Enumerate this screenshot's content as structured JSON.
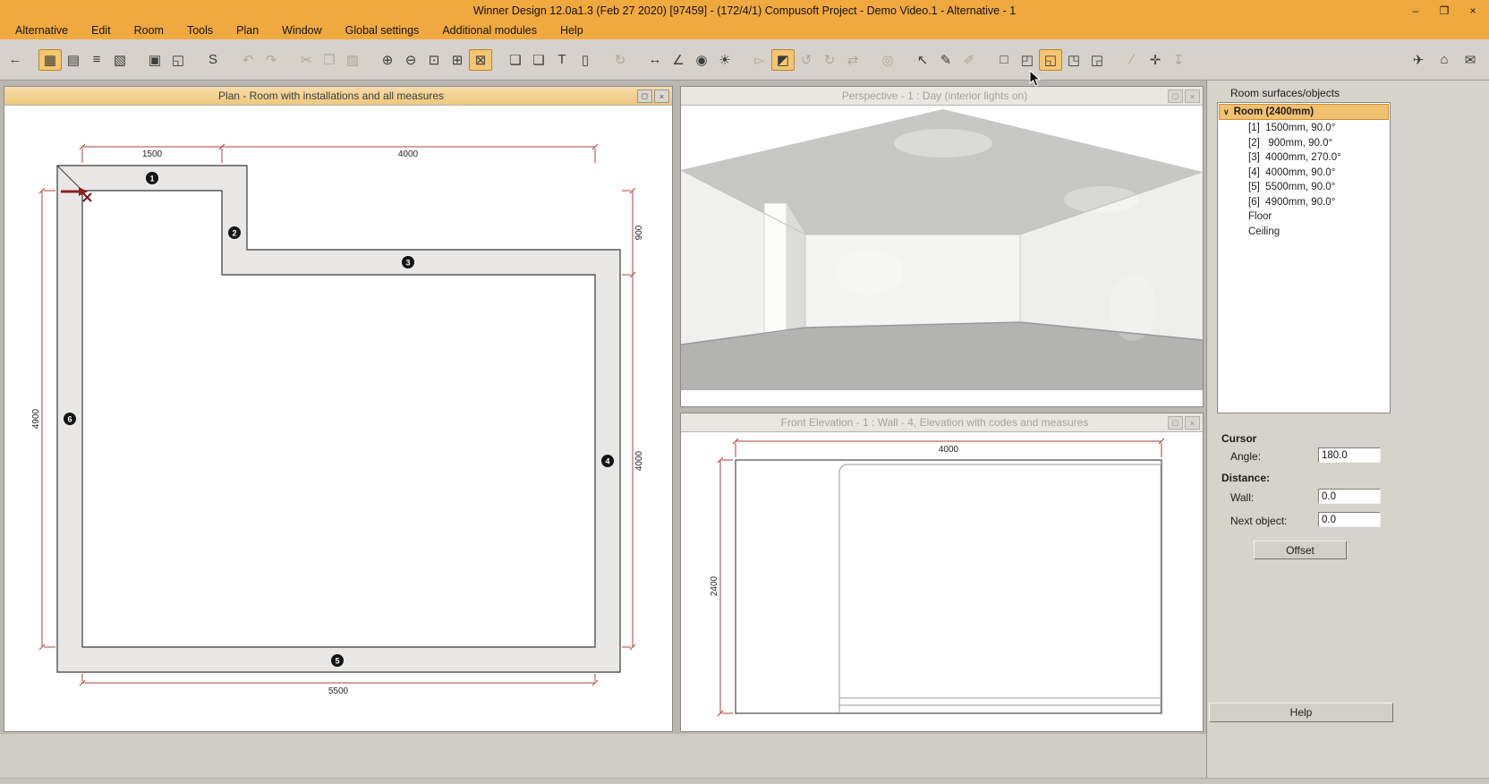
{
  "titlebar": {
    "title": "Winner Design 12.0a1.3  (Feb 27 2020) [97459] -  (172/4/1) Compusoft Project - Demo Video.1 - Alternative - 1",
    "minimize_glyph": "–",
    "maximize_glyph": "❐",
    "close_glyph": "×"
  },
  "menu_bar": {
    "items": [
      {
        "label": "Alternative",
        "name": "menu-alternative"
      },
      {
        "label": "Edit",
        "name": "menu-edit"
      },
      {
        "label": "Room",
        "name": "menu-room"
      },
      {
        "label": "Tools",
        "name": "menu-tools"
      },
      {
        "label": "Plan",
        "name": "menu-plan"
      },
      {
        "label": "Window",
        "name": "menu-window"
      },
      {
        "label": "Global settings",
        "name": "menu-global-settings"
      },
      {
        "label": "Additional modules",
        "name": "menu-additional-modules"
      },
      {
        "label": "Help",
        "name": "menu-help"
      }
    ]
  },
  "toolbar": {
    "icons": [
      {
        "name": "back-icon",
        "glyph": "←"
      },
      {
        "name": "plan-view-icon",
        "glyph": "▦",
        "state": "active",
        "sep": true
      },
      {
        "name": "elevation-view-icon",
        "glyph": "▤"
      },
      {
        "name": "item-list-icon",
        "glyph": "≡"
      },
      {
        "name": "perspective-view-icon",
        "glyph": "▧"
      },
      {
        "name": "print-icon",
        "glyph": "▣",
        "sep": true
      },
      {
        "name": "print-preview-icon",
        "glyph": "◱"
      },
      {
        "name": "price-calc-icon",
        "glyph": "S",
        "sep": true
      },
      {
        "name": "undo-icon",
        "glyph": "↶",
        "state": "disabled",
        "sep": true
      },
      {
        "name": "redo-icon",
        "glyph": "↷",
        "state": "disabled"
      },
      {
        "name": "cut-icon",
        "glyph": "✂",
        "state": "disabled",
        "sep": true
      },
      {
        "name": "copy-icon",
        "glyph": "❐",
        "state": "disabled"
      },
      {
        "name": "paste-icon",
        "glyph": "▨",
        "state": "disabled"
      },
      {
        "name": "zoom-in-icon",
        "glyph": "⊕",
        "sep": true
      },
      {
        "name": "zoom-out-icon",
        "glyph": "⊖"
      },
      {
        "name": "zoom-window-icon",
        "glyph": "⊡"
      },
      {
        "name": "zoom-all-icon",
        "glyph": "⊞"
      },
      {
        "name": "zoom-room-icon",
        "glyph": "⊠",
        "state": "active"
      },
      {
        "name": "note-icon",
        "glyph": "❏",
        "sep": true
      },
      {
        "name": "comment-icon",
        "glyph": "❑"
      },
      {
        "name": "text-icon",
        "glyph": "T"
      },
      {
        "name": "label-icon",
        "glyph": "▯"
      },
      {
        "name": "refresh-icon",
        "glyph": "↻",
        "state": "disabled",
        "sep": true
      },
      {
        "name": "measure-icon",
        "glyph": "↔",
        "sep": true
      },
      {
        "name": "protractor-icon",
        "glyph": "∠"
      },
      {
        "name": "camera-icon",
        "glyph": "◉"
      },
      {
        "name": "light-icon",
        "glyph": "☀"
      },
      {
        "name": "select-object-icon",
        "glyph": "▻",
        "state": "disabled",
        "sep": true
      },
      {
        "name": "cabinet-3d-icon",
        "glyph": "◩",
        "state": "active"
      },
      {
        "name": "rotate-left-icon",
        "glyph": "↺",
        "state": "disabled"
      },
      {
        "name": "rotate-right-icon",
        "glyph": "↻",
        "state": "disabled"
      },
      {
        "name": "align-icon",
        "glyph": "⇄",
        "state": "disabled"
      },
      {
        "name": "database-icon",
        "glyph": "◎",
        "state": "disabled",
        "sep": true
      },
      {
        "name": "pointer-icon",
        "glyph": "↖",
        "sep": true
      },
      {
        "name": "draw-wall-icon",
        "glyph": "✎"
      },
      {
        "name": "draw-free-icon",
        "glyph": "✐",
        "state": "disabled"
      },
      {
        "name": "wall-tool-icon",
        "glyph": "□",
        "sep": true
      },
      {
        "name": "room-corner-icon",
        "glyph": "◰"
      },
      {
        "name": "room-measures-icon",
        "glyph": "◱",
        "state": "active"
      },
      {
        "name": "wall-dim-icon",
        "glyph": "◳"
      },
      {
        "name": "wall-note-icon",
        "glyph": "◲"
      },
      {
        "name": "diagonal-line-icon",
        "glyph": "∕",
        "state": "disabled",
        "sep": true
      },
      {
        "name": "snap-icon",
        "glyph": "✛"
      },
      {
        "name": "import-icon",
        "glyph": "↧",
        "state": "disabled"
      }
    ],
    "right_icons": [
      {
        "name": "send-plan-icon",
        "glyph": "✈"
      },
      {
        "name": "catalog-icon",
        "glyph": "⌂"
      },
      {
        "name": "email-icon",
        "glyph": "✉"
      }
    ]
  },
  "plan_window": {
    "title": "Plan - Room with installations and all measures",
    "maximize_glyph": "◻",
    "close_glyph": "×",
    "dims": {
      "top_left": "1500",
      "top_right": "4000",
      "right_top": "900",
      "right_bottom": "4000",
      "left": "4900",
      "bottom": "5500"
    },
    "markers": [
      "1",
      "2",
      "3",
      "4",
      "5",
      "6"
    ]
  },
  "perspective_window": {
    "title": "Perspective - 1 : Day (interior lights on)",
    "maximize_glyph": "◻",
    "close_glyph": "×"
  },
  "elevation_window": {
    "title": "Front Elevation - 1 : Wall - 4, Elevation with codes and measures",
    "maximize_glyph": "◻",
    "close_glyph": "×",
    "dims": {
      "width": "4000",
      "height": "2400"
    }
  },
  "panel": {
    "title": "Room surfaces/objects",
    "chevron": "∨",
    "root_label": "Room (2400mm)",
    "items": [
      {
        "label": "[1]  1500mm, 90.0°",
        "name": "tree-item-wall-1"
      },
      {
        "label": "[2]   900mm, 90.0°",
        "name": "tree-item-wall-2"
      },
      {
        "label": "[3]  4000mm, 270.0°",
        "name": "tree-item-wall-3"
      },
      {
        "label": "[4]  4000mm, 90.0°",
        "name": "tree-item-wall-4"
      },
      {
        "label": "[5]  5500mm, 90.0°",
        "name": "tree-item-wall-5"
      },
      {
        "label": "[6]  4900mm, 90.0°",
        "name": "tree-item-wall-6"
      },
      {
        "label": "Floor",
        "name": "tree-item-floor"
      },
      {
        "label": "Ceiling",
        "name": "tree-item-ceiling"
      }
    ],
    "cursor_label": "Cursor",
    "angle_label": "Angle:",
    "angle_value": "180.0",
    "distance_label": "Distance:",
    "wall_label": "Wall:",
    "wall_value": "0.0",
    "next_object_label": "Next object:",
    "next_object_value": "0.0",
    "offset_button": "Offset",
    "help_button": "Help"
  }
}
